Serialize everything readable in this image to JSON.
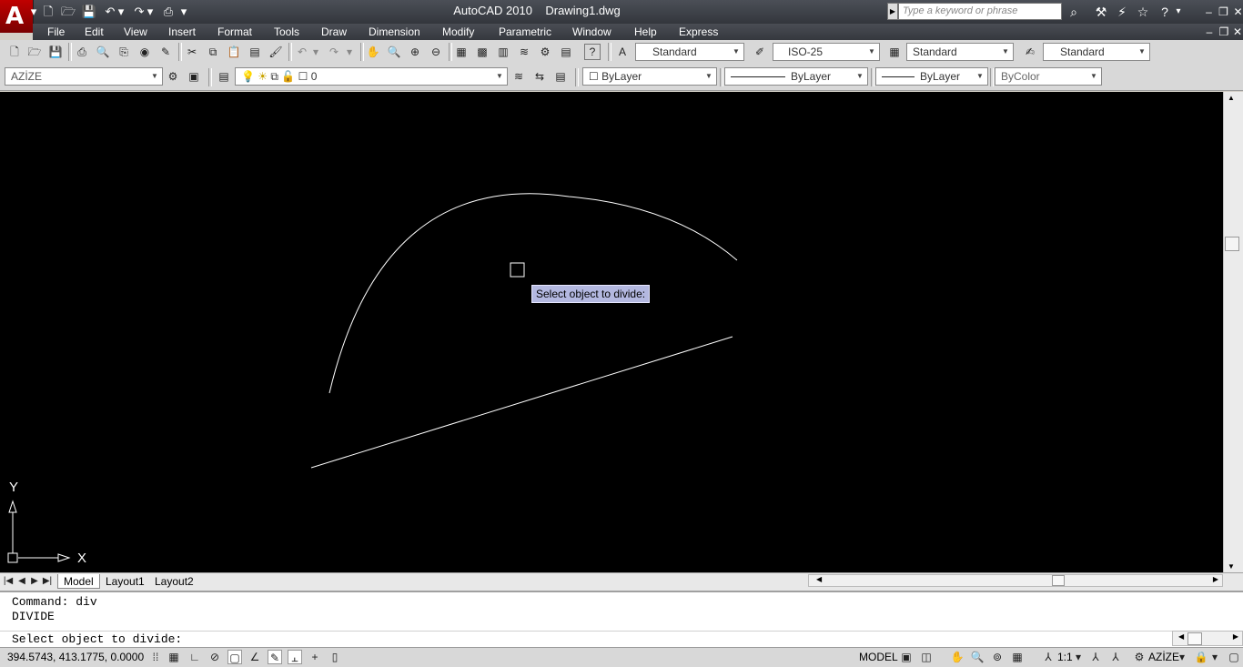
{
  "title": {
    "app": "AutoCAD 2010",
    "document": "Drawing1.dwg"
  },
  "search": {
    "placeholder": "Type a keyword or phrase"
  },
  "menu": [
    "File",
    "Edit",
    "View",
    "Insert",
    "Format",
    "Tools",
    "Draw",
    "Dimension",
    "Modify",
    "Parametric",
    "Window",
    "Help",
    "Express"
  ],
  "styles": {
    "text_style": "Standard",
    "dim_style": "ISO-25",
    "table_style": "Standard",
    "multileader_style": "Standard"
  },
  "layers": {
    "workspace": "AZİZE",
    "current_layer": "0",
    "color": "ByLayer",
    "linetype": "ByLayer",
    "lineweight": "ByLayer",
    "plot_style": "ByColor"
  },
  "canvas": {
    "tooltip": "Select object to divide:",
    "ucs_x": "X",
    "ucs_y": "Y"
  },
  "tabs": [
    "Model",
    "Layout1",
    "Layout2"
  ],
  "active_tab": "Model",
  "command": {
    "history": [
      "Command: div",
      "DIVIDE"
    ],
    "prompt": "Select object to divide:"
  },
  "status": {
    "coordinates": "394.5743, 413.1775, 0.0000",
    "space": "MODEL",
    "annotation_scale": "1:1",
    "workspace": "AZİZE"
  }
}
